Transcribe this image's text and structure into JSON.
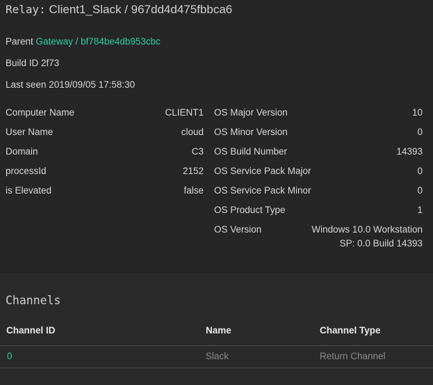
{
  "title": {
    "prefix": "Relay:",
    "name": "Client1_Slack / 967dd4d475fbbca6"
  },
  "info": {
    "parent_label": "Parent",
    "parent_link": "Gateway / bf784be4db953cbc",
    "build_id": "Build ID 2f73",
    "last_seen": "Last seen 2019/09/05 17:58:30"
  },
  "left_props": [
    {
      "key": "Computer Name",
      "value": "CLIENT1"
    },
    {
      "key": "User Name",
      "value": "cloud"
    },
    {
      "key": "Domain",
      "value": "C3"
    },
    {
      "key": "processId",
      "value": "2152"
    },
    {
      "key": "is Elevated",
      "value": "false"
    }
  ],
  "right_props": [
    {
      "key": "OS Major Version",
      "value": "10"
    },
    {
      "key": "OS Minor Version",
      "value": "0"
    },
    {
      "key": "OS Build Number",
      "value": "14393"
    },
    {
      "key": "OS Service Pack Major",
      "value": "0"
    },
    {
      "key": "OS Service Pack Minor",
      "value": "0"
    },
    {
      "key": "OS Product Type",
      "value": "1"
    },
    {
      "key": "OS Version",
      "value_line1": "Windows 10.0 Workstation",
      "value_line2": "SP: 0.0 Build 14393"
    }
  ],
  "channels": {
    "title": "Channels",
    "headers": {
      "id": "Channel ID",
      "name": "Name",
      "type": "Channel Type"
    },
    "rows": [
      {
        "id": "0",
        "name": "Slack",
        "type": "Return Channel"
      }
    ]
  },
  "colors": {
    "background": "#232323",
    "accent": "#2fd0a0",
    "muted": "#8a8a8a"
  }
}
